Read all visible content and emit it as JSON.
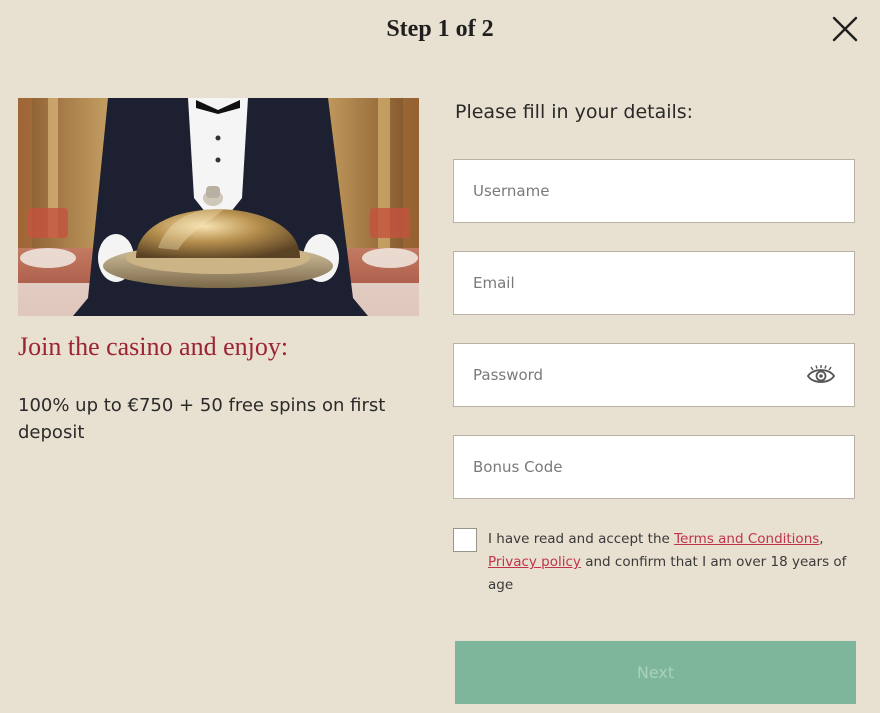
{
  "header": {
    "title": "Step 1 of 2",
    "close_icon": "close-icon"
  },
  "promo": {
    "image_icon": "butler-with-cloche-image",
    "heading": "Join the casino and enjoy:",
    "offer": "100% up to €750 + 50 free spins on first deposit"
  },
  "form": {
    "title": "Please fill in your details:",
    "username_placeholder": "Username",
    "email_placeholder": "Email",
    "password_placeholder": "Password",
    "password_toggle_icon": "eye-icon",
    "bonus_placeholder": "Bonus Code",
    "consent": {
      "checked": false,
      "prefix": "I have read and accept the ",
      "terms_link": "Terms and Conditions",
      "separator": ", ",
      "privacy_link": "Privacy policy",
      "suffix": " and confirm that I am over 18 years of age"
    },
    "next_label": "Next"
  },
  "colors": {
    "background": "#e8e0d0",
    "accent_red": "#9b2333",
    "link_red": "#c0344a",
    "button_green": "#7db69b"
  }
}
